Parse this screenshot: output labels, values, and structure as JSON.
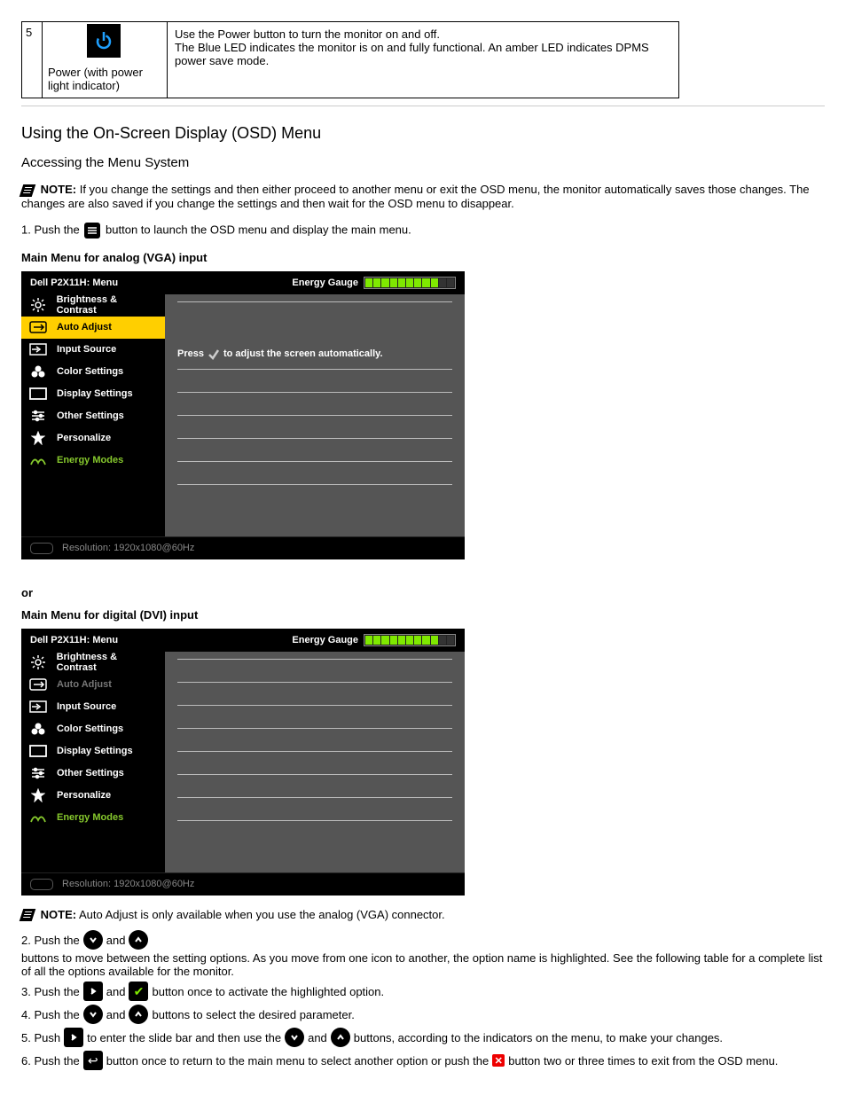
{
  "top_table": {
    "button_num": "5",
    "button_label": "Power (with power light indicator)",
    "button_desc": "Use the Power button to turn the monitor on and off.\nThe Blue LED indicates the monitor is on and fully functional. An amber LED indicates DPMS power save mode."
  },
  "osd_section": {
    "heading": "Using the On-Screen Display (OSD) Menu",
    "sub_heading": "Accessing the Menu System",
    "note_label": "NOTE:",
    "note_text": "If you change the settings and then either proceed to another menu or exit the OSD menu, the monitor automatically saves those changes. The changes are also saved if you change the settings and then wait for the OSD menu to disappear.",
    "step1": "1. Push the     button to launch the OSD menu and display the main menu.",
    "fig1_caption": "Main Menu for analog (VGA) input",
    "fig2_intro": "or",
    "fig2_caption": "Main Menu for digital (DVI) input"
  },
  "menus": [
    {
      "title": "Dell P2X11H: Menu",
      "energy_label": "Energy Gauge",
      "items": [
        {
          "label": "Brightness & Contrast",
          "icon": "brightness",
          "style": ""
        },
        {
          "label": "Auto Adjust",
          "icon": "autoadjust",
          "style": "selected"
        },
        {
          "label": "Input Source",
          "icon": "input",
          "style": ""
        },
        {
          "label": "Color Settings",
          "icon": "color",
          "style": ""
        },
        {
          "label": "Display Settings",
          "icon": "display",
          "style": ""
        },
        {
          "label": "Other Settings",
          "icon": "other",
          "style": ""
        },
        {
          "label": "Personalize",
          "icon": "personalize",
          "style": ""
        },
        {
          "label": "Energy Modes",
          "icon": "energy",
          "style": "green"
        }
      ],
      "main_msg_prefix": "Press",
      "main_msg_suffix": "to adjust the screen automatically.",
      "resolution": "Resolution: 1920x1080@60Hz"
    },
    {
      "title": "Dell P2X11H: Menu",
      "energy_label": "Energy Gauge",
      "items": [
        {
          "label": "Brightness & Contrast",
          "icon": "brightness",
          "style": ""
        },
        {
          "label": "Auto Adjust",
          "icon": "autoadjust",
          "style": "dim"
        },
        {
          "label": "Input Source",
          "icon": "input",
          "style": ""
        },
        {
          "label": "Color Settings",
          "icon": "color",
          "style": ""
        },
        {
          "label": "Display Settings",
          "icon": "display",
          "style": ""
        },
        {
          "label": "Other Settings",
          "icon": "other",
          "style": ""
        },
        {
          "label": "Personalize",
          "icon": "personalize",
          "style": ""
        },
        {
          "label": "Energy Modes",
          "icon": "energy",
          "style": "green"
        }
      ],
      "main_msg_prefix": "",
      "main_msg_suffix": "",
      "resolution": "Resolution: 1920x1080@60Hz"
    }
  ],
  "post_note": {
    "label": "NOTE:",
    "text": "Auto Adjust is only available when you use the analog (VGA) connector."
  },
  "steps": {
    "s2a": "2. Push the",
    "s2b": "and",
    "s2c": "buttons to move between the setting options. As you move from one icon to another, the option name is highlighted. See the following table for a complete list of all the options available for the monitor.",
    "s3a": "3. Push the",
    "s3b": "and",
    "s3c": "button once to activate the highlighted option.",
    "s4a": "4. Push the",
    "s4b": "and",
    "s4c": "buttons to select the desired parameter.",
    "s5a": "5. Push",
    "s5b": "to enter the slide bar and then use the",
    "s5c": "and",
    "s5d": "buttons, according to the indicators on the menu, to make your changes.",
    "s6a": "6. Push the",
    "s6b": "button once to return to the main menu to select another option or push the",
    "s6c": "button two or three times to exit from the OSD menu."
  }
}
